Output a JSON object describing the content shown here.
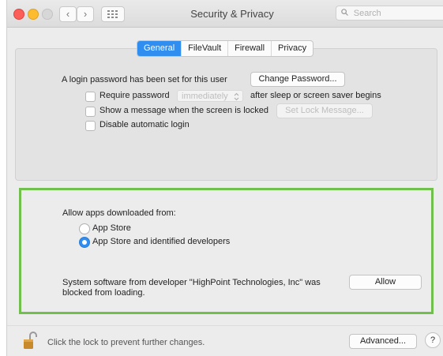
{
  "window": {
    "title": "Security & Privacy"
  },
  "toolbar": {
    "back_glyph": "‹",
    "forward_glyph": "›",
    "search_placeholder": "Search"
  },
  "tabs": [
    {
      "label": "General",
      "selected": true
    },
    {
      "label": "FileVault",
      "selected": false
    },
    {
      "label": "Firewall",
      "selected": false
    },
    {
      "label": "Privacy",
      "selected": false
    }
  ],
  "general": {
    "login_text": "A login password has been set for this user",
    "change_password_label": "Change Password...",
    "require_password_label": "Require password",
    "require_password_checked": false,
    "require_password_select_value": "immediately",
    "require_password_suffix": "after sleep or screen saver begins",
    "show_message_label": "Show a message when the screen is locked",
    "show_message_checked": false,
    "set_lock_message_label": "Set Lock Message...",
    "disable_auto_login_label": "Disable automatic login",
    "disable_auto_login_checked": false
  },
  "allow_apps": {
    "heading": "Allow apps downloaded from:",
    "options": [
      {
        "label": "App Store",
        "selected": false
      },
      {
        "label": "App Store and identified developers",
        "selected": true
      }
    ],
    "blocked_message_line1": "System software from developer \"HighPoint Technologies, Inc\" was",
    "blocked_message_line2": "blocked from loading.",
    "allow_button_label": "Allow",
    "highlight_color": "#71c04d"
  },
  "footer": {
    "lock_text": "Click the lock to prevent further changes.",
    "advanced_label": "Advanced...",
    "help_label": "?"
  },
  "colors": {
    "accent": "#2f8ef0",
    "window_bg": "#ececec"
  },
  "icons": {
    "lock": "lock-open-icon",
    "search": "search-icon",
    "grid": "grid-icon",
    "chevron": "chevron-updown-icon"
  }
}
